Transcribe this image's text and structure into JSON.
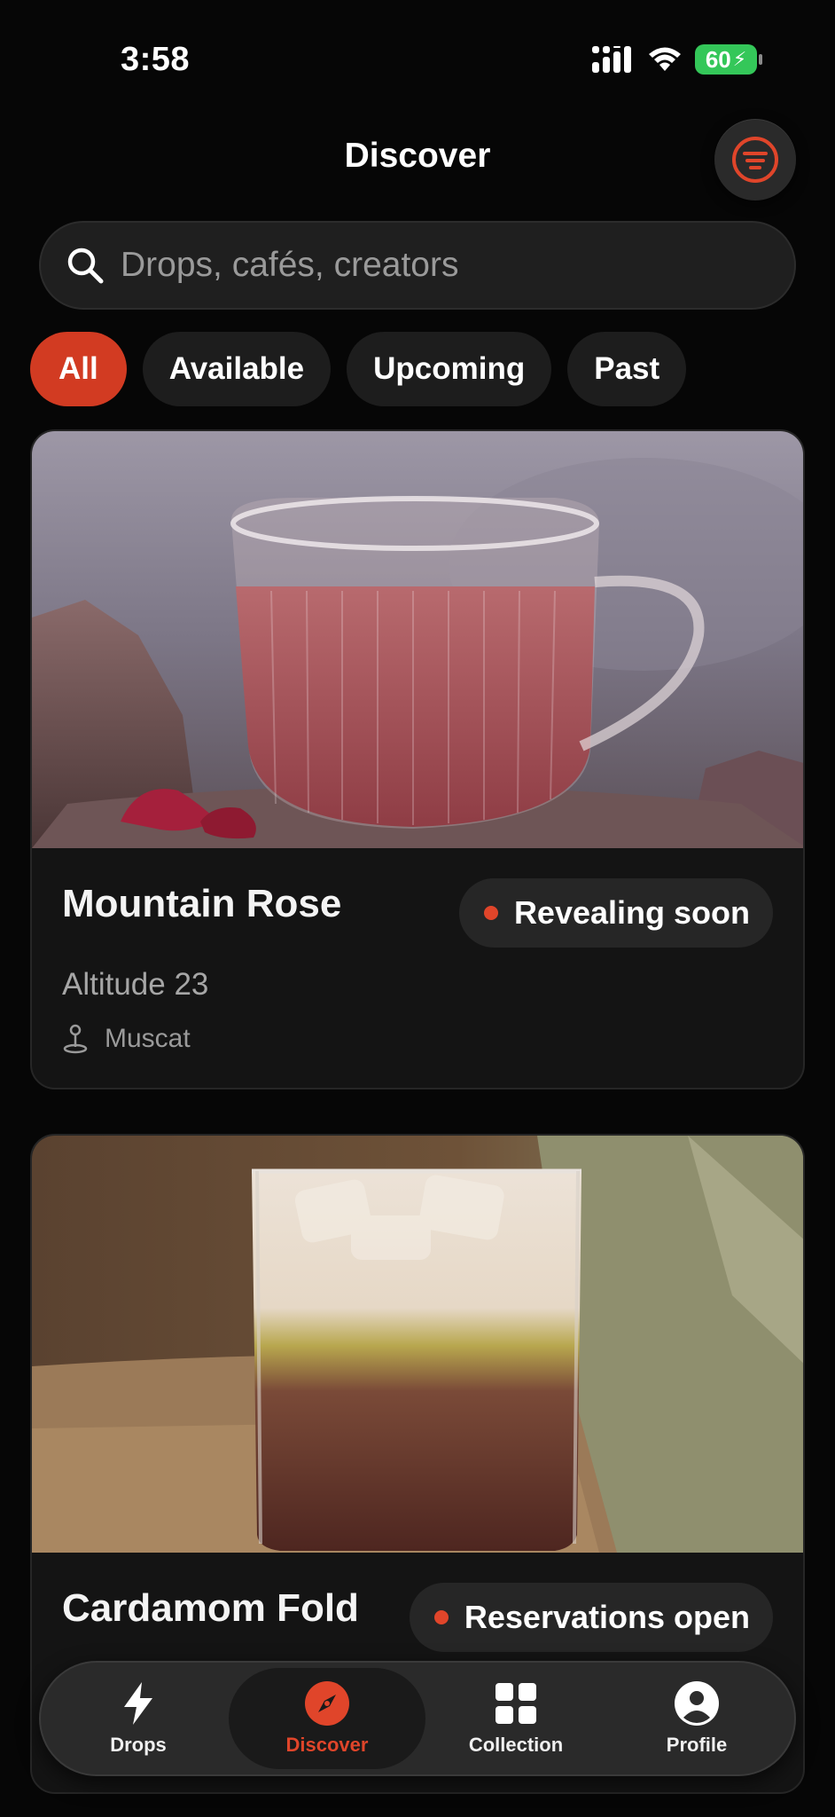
{
  "status_bar": {
    "time": "3:58",
    "battery": "60"
  },
  "header": {
    "title": "Discover"
  },
  "search": {
    "placeholder": "Drops, cafés, creators"
  },
  "filters": [
    {
      "label": "All",
      "active": true
    },
    {
      "label": "Available",
      "active": false
    },
    {
      "label": "Upcoming",
      "active": false
    },
    {
      "label": "Past",
      "active": false
    }
  ],
  "cards": [
    {
      "title": "Mountain Rose",
      "status": "Revealing soon",
      "cafe": "Altitude 23",
      "location": "Muscat"
    },
    {
      "title": "Cardamom Fold",
      "status": "Reservations open"
    }
  ],
  "tabbar": {
    "items": [
      {
        "label": "Drops",
        "icon": "bolt-icon"
      },
      {
        "label": "Discover",
        "icon": "compass-icon",
        "active": true
      },
      {
        "label": "Collection",
        "icon": "grid-icon"
      },
      {
        "label": "Profile",
        "icon": "profile-icon"
      }
    ]
  },
  "colors": {
    "accent": "#d23b22",
    "background": "#060606",
    "card": "#141414"
  }
}
